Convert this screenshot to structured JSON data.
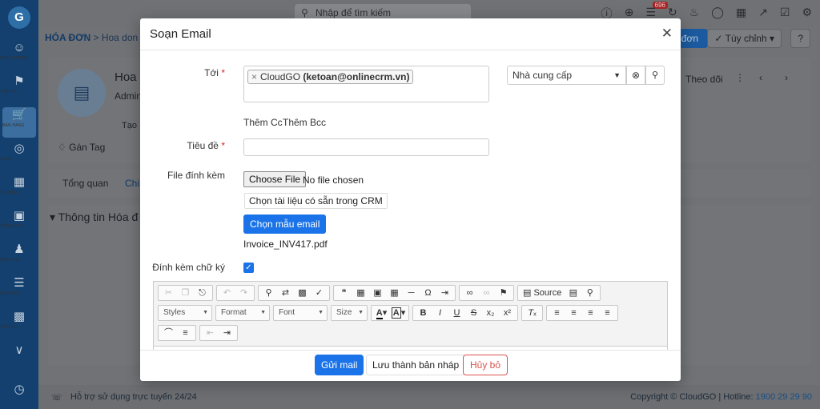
{
  "sidebar": {
    "logo": "G",
    "items": [
      {
        "label": "KHÁCH HÀNG",
        "icon": "users-icon"
      },
      {
        "label": "TIẾP THỊ",
        "icon": "megaphone-icon"
      },
      {
        "label": "BÁN HÀNG",
        "icon": "cart-icon",
        "active": true
      },
      {
        "label": "CSKH",
        "icon": "lifebuoy-icon"
      },
      {
        "label": "SỰ KIỆN",
        "icon": "calendar-icon"
      },
      {
        "label": "CÔNG VIỆC",
        "icon": "briefcase-icon"
      },
      {
        "label": "NHÂN SỰ",
        "icon": "person-icon"
      },
      {
        "label": "BÁO CÁO",
        "icon": "report-icon"
      },
      {
        "label": "TIỆN ÍCH",
        "icon": "widgets-icon"
      }
    ]
  },
  "topbar": {
    "search_placeholder": "Nhập để tìm kiếm",
    "badge": "696"
  },
  "page": {
    "breadcrumb_root": "HÓA ĐƠN",
    "breadcrumb_sep": ">",
    "breadcrumb_current": "Hoa don Te",
    "create_button": "đơn",
    "customize_button": "Tùy chỉnh",
    "record_title": "Hoa c",
    "record_owner": "Admin",
    "created_prefix": "Tạo",
    "tag_button": "Gán Tag",
    "follow_button": "Theo dõi",
    "tab_overview": "Tổng quan",
    "tab_detail": "Chi",
    "section_title": "Thông tin Hóa đ"
  },
  "footer": {
    "support": "Hỗ trợ sử dụng trực tuyến 24/24",
    "copyright": "Copyright © CloudGO | Hotline: ",
    "hotline": "1900 29 29 90"
  },
  "modal": {
    "title": "Soạn Email",
    "to_label": "Tới",
    "to_recipient_name": "CloudGO",
    "to_recipient_email": "(ketoan@onlinecrm.vn)",
    "vendor_select": "Nhà cung cấp",
    "add_cc": "Thêm Cc",
    "add_bcc": "Thêm Bcc",
    "subject_label": "Tiêu đề",
    "subject_value": "",
    "attachment_label": "File đính kèm",
    "choose_file": "Choose File",
    "no_file": "No file chosen",
    "crm_doc_button": "Chọn tài liệu có sẵn trong CRM",
    "template_button": "Chọn mẫu email",
    "attached_file": "Invoice_INV417.pdf",
    "signature_label": "Đính kèm chữ ký",
    "signature_checked": true,
    "editor": {
      "source_label": "Source",
      "styles": "Styles",
      "format": "Format",
      "font": "Font",
      "size": "Size"
    },
    "send_button": "Gửi mail",
    "draft_button": "Lưu thành bản nháp",
    "cancel_button": "Hủy bỏ"
  }
}
